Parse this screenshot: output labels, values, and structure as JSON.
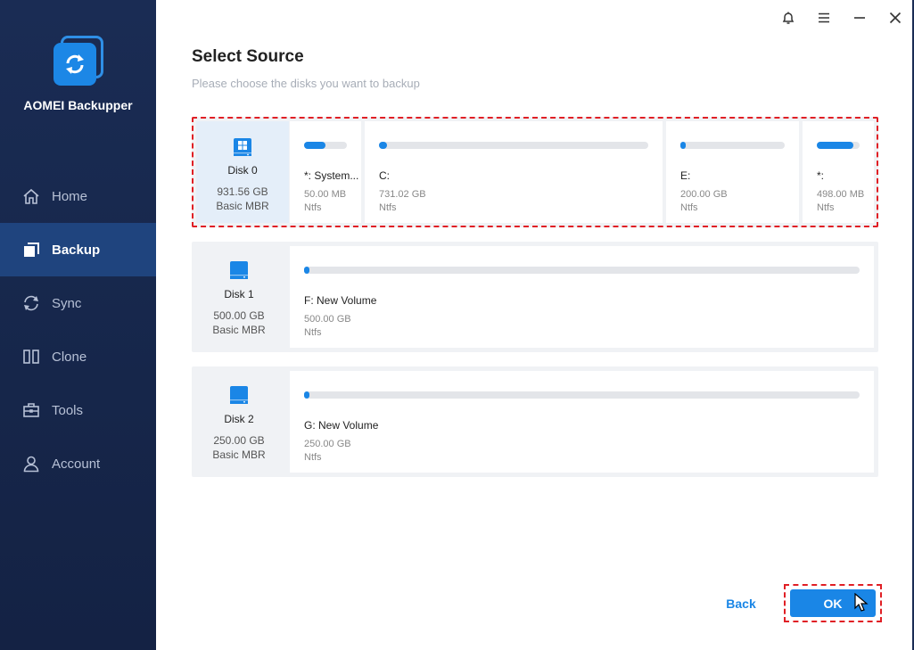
{
  "app": {
    "name": "AOMEI Backupper"
  },
  "nav": [
    {
      "id": "home",
      "label": "Home",
      "icon": "home-icon",
      "active": false
    },
    {
      "id": "backup",
      "label": "Backup",
      "icon": "backup-icon",
      "active": true
    },
    {
      "id": "sync",
      "label": "Sync",
      "icon": "sync-icon",
      "active": false
    },
    {
      "id": "clone",
      "label": "Clone",
      "icon": "clone-icon",
      "active": false
    },
    {
      "id": "tools",
      "label": "Tools",
      "icon": "tools-icon",
      "active": false
    },
    {
      "id": "account",
      "label": "Account",
      "icon": "account-icon",
      "active": false
    }
  ],
  "page": {
    "title": "Select Source",
    "subtitle": "Please choose the disks you want to backup"
  },
  "disks": [
    {
      "name": "Disk 0",
      "size": "931.56 GB",
      "type": "Basic MBR",
      "selected": true,
      "icon": "windows-disk-icon",
      "partitions": [
        {
          "name": "*: System...",
          "size": "50.00 MB",
          "fs": "Ntfs",
          "used": 0.5
        },
        {
          "name": "C:",
          "size": "731.02 GB",
          "fs": "Ntfs",
          "used": 0.03
        },
        {
          "name": "E:",
          "size": "200.00 GB",
          "fs": "Ntfs",
          "used": 0.03
        },
        {
          "name": "*:",
          "size": "498.00 MB",
          "fs": "Ntfs",
          "used": 0.85
        }
      ]
    },
    {
      "name": "Disk 1",
      "size": "500.00 GB",
      "type": "Basic MBR",
      "selected": false,
      "icon": "disk-icon",
      "partitions": [
        {
          "name": "F: New Volume",
          "size": "500.00 GB",
          "fs": "Ntfs",
          "used": 0.005
        }
      ]
    },
    {
      "name": "Disk 2",
      "size": "250.00 GB",
      "type": "Basic MBR",
      "selected": false,
      "icon": "disk-icon",
      "partitions": [
        {
          "name": "G: New Volume",
          "size": "250.00 GB",
          "fs": "Ntfs",
          "used": 0.005
        }
      ]
    }
  ],
  "buttons": {
    "back": "Back",
    "ok": "OK"
  },
  "colors": {
    "accent": "#1a86e6",
    "sidebar": "#1a2c54",
    "active_nav": "#1f447e",
    "highlight": "#e01f25"
  }
}
